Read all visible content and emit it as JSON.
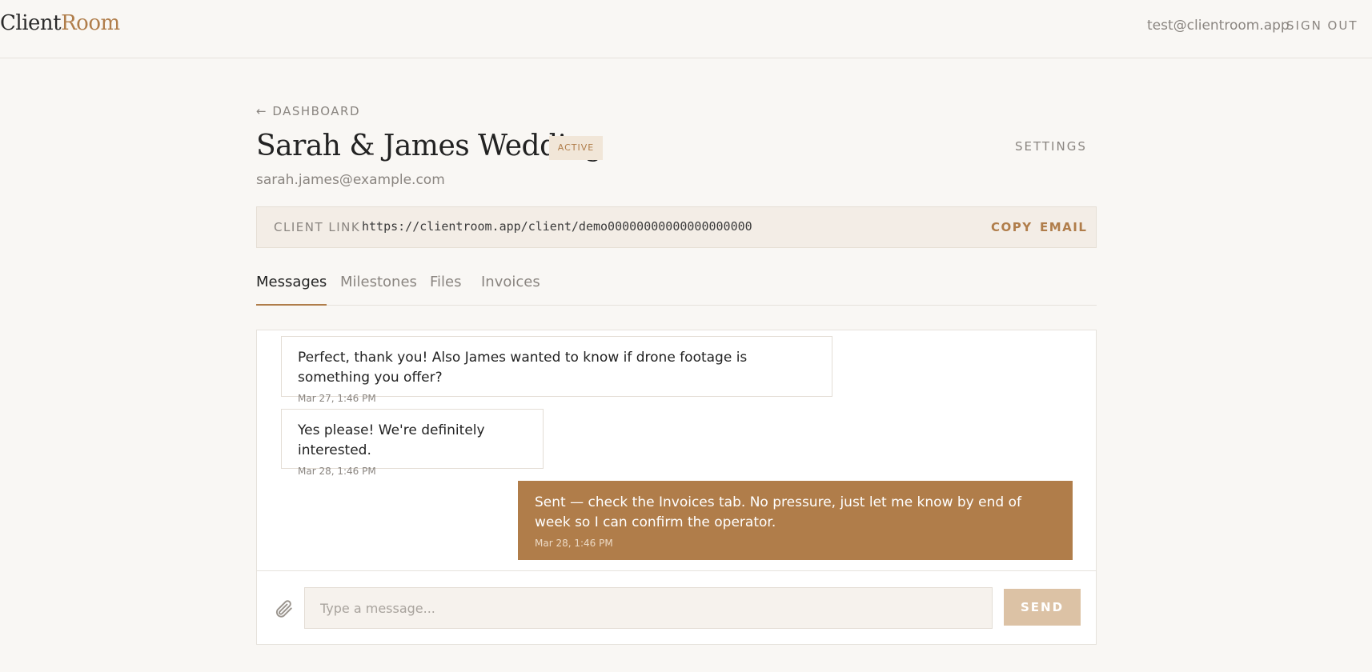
{
  "header": {
    "logo_part1": "Client",
    "logo_part2": "Room",
    "user_email": "test@clientroom.app",
    "sign_out": "SIGN OUT"
  },
  "project": {
    "back_label": "← DASHBOARD",
    "title": "Sarah & James Wedding",
    "status": "ACTIVE",
    "settings_label": "SETTINGS",
    "client_email": "sarah.james@example.com"
  },
  "client_link": {
    "label": "CLIENT LINK",
    "url": "https://clientroom.app/client/demo00000000000000000000",
    "copy_label": "COPY",
    "email_label": "EMAIL"
  },
  "tabs": [
    {
      "label": "Messages",
      "active": true
    },
    {
      "label": "Milestones",
      "active": false
    },
    {
      "label": "Files",
      "active": false
    },
    {
      "label": "Invoices",
      "active": false
    }
  ],
  "messages": [
    {
      "text": "Perfect, thank you! Also James wanted to know if drone footage is something you offer?",
      "time": "Mar 27, 1:46 PM",
      "from": "client"
    },
    {
      "text": "Yes please! We're definitely interested.",
      "time": "Mar 28, 1:46 PM",
      "from": "client"
    },
    {
      "text": "Sent — check the Invoices tab. No pressure, just let me know by end of week so I can confirm the operator.",
      "time": "Mar 28, 1:46 PM",
      "from": "me"
    }
  ],
  "composer": {
    "placeholder": "Type a message...",
    "value": "",
    "send_label": "SEND"
  },
  "colors": {
    "accent": "#b07d4a",
    "background": "#f9f7f4",
    "badge_bg": "#f1e6d8",
    "send_disabled": "#dcc2a5"
  },
  "icons": {
    "attach": "paperclip-icon"
  }
}
